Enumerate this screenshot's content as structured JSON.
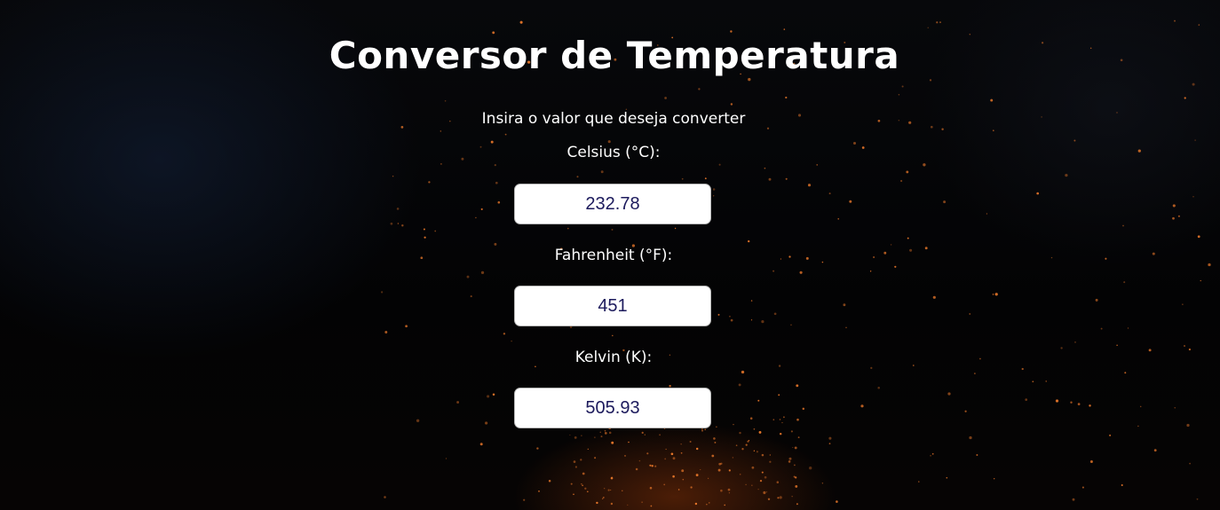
{
  "page": {
    "title": "Conversor de Temperatura",
    "subtitle": "Insira o valor que deseja converter"
  },
  "fields": [
    {
      "label": "Celsius (°C):",
      "value": "232.78"
    },
    {
      "label": "Fahrenheit (°F):",
      "value": "451"
    },
    {
      "label": "Kelvin (K):",
      "value": "505.93"
    }
  ],
  "colors": {
    "background": "#040405",
    "text": "#ffffff",
    "input_background": "#ffffff",
    "input_text": "#1c1a5c",
    "spark": "#e8772a"
  }
}
